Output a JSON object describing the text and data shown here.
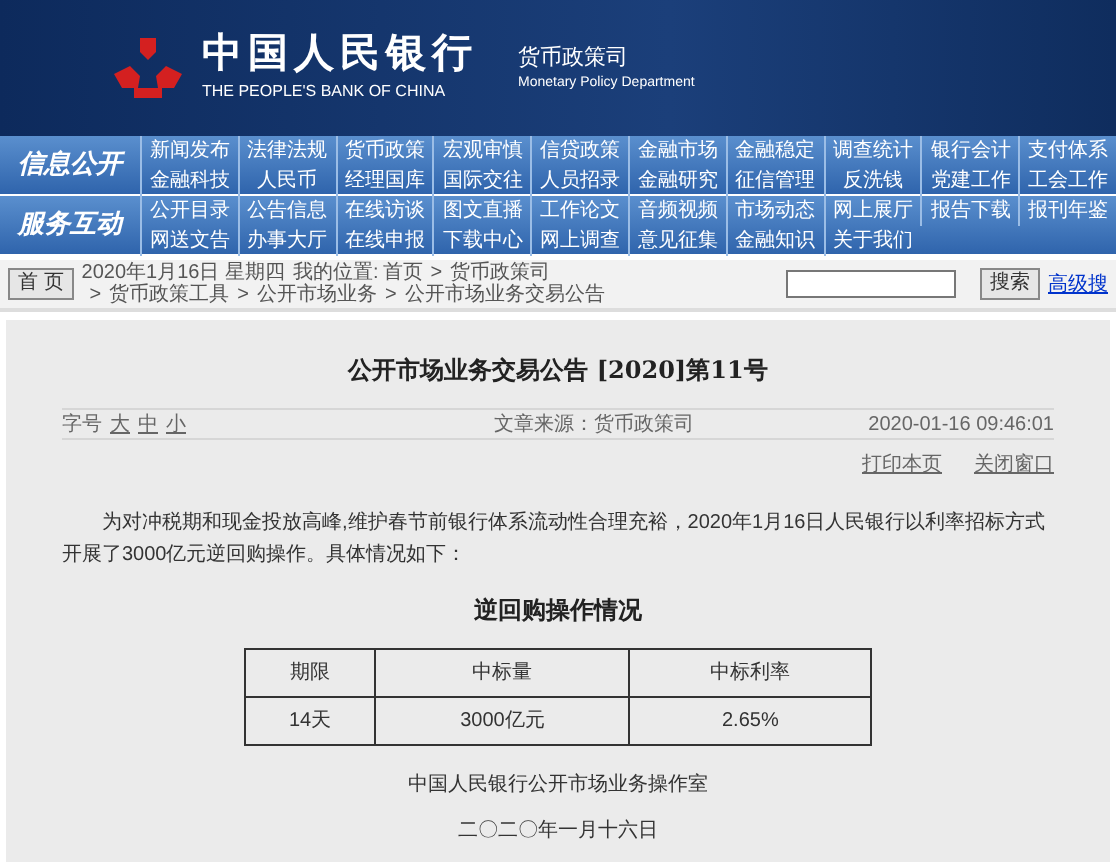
{
  "header": {
    "bank_name_cn": "中国人民银行",
    "bank_name_en": "THE PEOPLE'S BANK OF CHINA",
    "department_cn": "货币政策司",
    "department_en": "Monetary Policy Department"
  },
  "nav": [
    {
      "label": "信息公开",
      "rows": [
        [
          "新闻发布",
          "法律法规",
          "货币政策",
          "宏观审慎",
          "信贷政策",
          "金融市场",
          "金融稳定",
          "调查统计",
          "银行会计",
          "支付体系"
        ],
        [
          "金融科技",
          "人民币",
          "经理国库",
          "国际交往",
          "人员招录",
          "金融研究",
          "征信管理",
          "反洗钱",
          "党建工作",
          "工会工作"
        ]
      ]
    },
    {
      "label": "服务互动",
      "rows": [
        [
          "公开目录",
          "公告信息",
          "在线访谈",
          "图文直播",
          "工作论文",
          "音频视频",
          "市场动态",
          "网上展厅",
          "报告下载",
          "报刊年鉴"
        ],
        [
          "网送文告",
          "办事大厅",
          "在线申报",
          "下载中心",
          "网上调查",
          "意见征集",
          "金融知识",
          "关于我们"
        ]
      ]
    }
  ],
  "toolbar": {
    "home_button": "首 页",
    "date": "2020年1月16日 星期四",
    "location_label": "我的位置:",
    "breadcrumbs": [
      "首页",
      "货币政策司",
      "货币政策工具",
      "公开市场业务",
      "公开市场业务交易公告"
    ],
    "separator": ">",
    "search_button": "搜索",
    "advanced_search": "高级搜"
  },
  "article": {
    "title": "公开市场业务交易公告 [2020]第11号",
    "font_size_label": "字号",
    "font_sizes": [
      "大",
      "中",
      "小"
    ],
    "source": "文章来源：货币政策司",
    "timestamp": "2020-01-16 09:46:01",
    "actions": [
      "打印本页",
      "关闭窗口"
    ],
    "paragraph": "为对冲税期和现金投放高峰,维护春节前银行体系流动性合理充裕，2020年1月16日人民银行以利率招标方式开展了3000亿元逆回购操作。具体情况如下：",
    "table_title": "逆回购操作情况",
    "table": {
      "columns": [
        "期限",
        "中标量",
        "中标利率"
      ],
      "rows": [
        [
          "14天",
          "3000亿元",
          "2.65%"
        ]
      ]
    },
    "signature": "中国人民银行公开市场业务操作室",
    "date": "二〇二〇年一月十六日"
  }
}
